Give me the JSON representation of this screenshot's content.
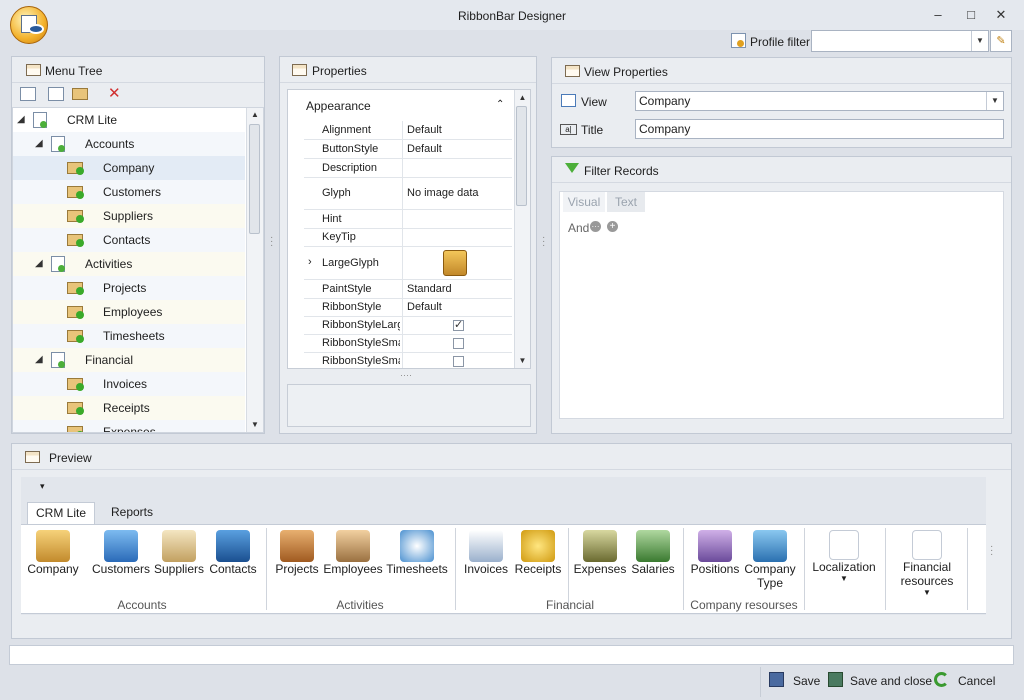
{
  "window": {
    "title": "RibbonBar Designer",
    "minimize_icon": "minimize-icon",
    "maximize_icon": "maximize-icon",
    "close_icon": "close-icon"
  },
  "profile_filter": {
    "label": "Profile filter:",
    "value": ""
  },
  "menu_tree": {
    "title": "Menu Tree",
    "toolbar": [
      "add-group-icon",
      "add-subgroup-icon",
      "add-item-icon",
      "delete-icon"
    ],
    "items": [
      {
        "label": "CRM Lite",
        "level": 0,
        "expanded": true
      },
      {
        "label": "Accounts",
        "level": 1,
        "expanded": true
      },
      {
        "label": "Company",
        "level": 2,
        "selected": true
      },
      {
        "label": "Customers",
        "level": 2
      },
      {
        "label": "Suppliers",
        "level": 2
      },
      {
        "label": "Contacts",
        "level": 2
      },
      {
        "label": "Activities",
        "level": 1,
        "expanded": true
      },
      {
        "label": "Projects",
        "level": 2
      },
      {
        "label": "Employees",
        "level": 2
      },
      {
        "label": "Timesheets",
        "level": 2
      },
      {
        "label": "Financial",
        "level": 1,
        "expanded": true
      },
      {
        "label": "Invoices",
        "level": 2
      },
      {
        "label": "Receipts",
        "level": 2
      },
      {
        "label": "Expenses",
        "level": 2
      }
    ]
  },
  "properties": {
    "title": "Properties",
    "category": "Appearance",
    "rows": [
      {
        "name": "Alignment",
        "value": "Default"
      },
      {
        "name": "ButtonStyle",
        "value": "Default"
      },
      {
        "name": "Description",
        "value": ""
      },
      {
        "name": "Glyph",
        "value": "No image data"
      },
      {
        "name": "Hint",
        "value": ""
      },
      {
        "name": "KeyTip",
        "value": ""
      },
      {
        "name": "LargeGlyph",
        "value": ""
      },
      {
        "name": "PaintStyle",
        "value": "Standard"
      },
      {
        "name": "RibbonStyle",
        "value": "Default"
      },
      {
        "name": "RibbonStyleLarge",
        "value": "",
        "checked": true
      },
      {
        "name": "RibbonStyleSmall",
        "value": "",
        "checked": false
      },
      {
        "name": "RibbonStyleSmall",
        "value": "",
        "checked": false
      }
    ]
  },
  "view_properties": {
    "title": "View Properties",
    "view_label": "View",
    "view_value": "Company",
    "title_label": "Title",
    "title_value": "Company"
  },
  "filter_records": {
    "title": "Filter Records",
    "tabs": [
      "Visual",
      "Text"
    ],
    "condition": "And"
  },
  "preview": {
    "title": "Preview",
    "tabs": [
      "CRM Lite",
      "Reports"
    ],
    "buttons": [
      {
        "label": "Company",
        "icon": "company-icon"
      },
      {
        "label": "Customers",
        "icon": "customers-icon"
      },
      {
        "label": "Suppliers",
        "icon": "suppliers-icon"
      },
      {
        "label": "Contacts",
        "icon": "contacts-icon"
      },
      {
        "label": "Projects",
        "icon": "projects-icon"
      },
      {
        "label": "Employees",
        "icon": "employees-icon"
      },
      {
        "label": "Timesheets",
        "icon": "timesheets-icon"
      },
      {
        "label": "Invoices",
        "icon": "invoices-icon"
      },
      {
        "label": "Receipts",
        "icon": "receipts-icon"
      },
      {
        "label": "Expenses",
        "icon": "expenses-icon"
      },
      {
        "label": "Salaries",
        "icon": "salaries-icon"
      },
      {
        "label": "Positions",
        "icon": "positions-icon"
      },
      {
        "label": "Company Type",
        "icon": "company-type-icon"
      },
      {
        "label": "Localization",
        "icon": "localization-icon"
      },
      {
        "label": "Financial resources",
        "icon": "financial-resources-icon"
      }
    ],
    "groups": [
      "Accounts",
      "Activities",
      "Financial",
      "Company resourses"
    ]
  },
  "footer": {
    "save": "Save",
    "save_close": "Save and close",
    "cancel": "Cancel"
  }
}
